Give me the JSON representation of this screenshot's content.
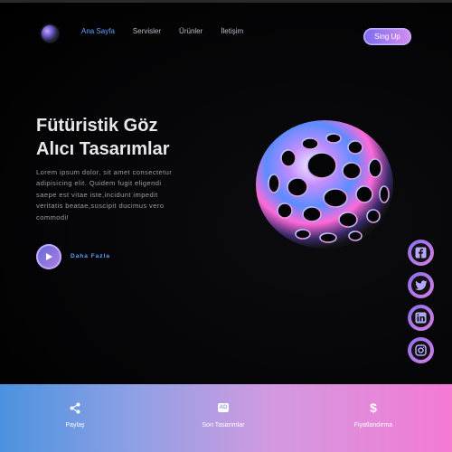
{
  "header": {
    "nav": [
      "Ana Sayfa",
      "Servisler",
      "Ürünler",
      "İletişim"
    ],
    "cta_label": "Sing Up",
    "logo_icon": "sphere-logo"
  },
  "hero": {
    "title_line1": "Fütüristik Göz",
    "title_line2": "Alıcı Tasarımlar",
    "lead": "Lorem ipsum dolor, sit amet consectetur adipisicing elit. Quidem fugit eligendi saepe est vitae iste,incidunt impedit veritatis beatae,suscipit ducimus vero commodi!",
    "more_label": "Daha Fazla",
    "play_icon": "play-icon"
  },
  "socials": [
    {
      "name": "facebook",
      "icon": "facebook-icon"
    },
    {
      "name": "twitter",
      "icon": "twitter-icon"
    },
    {
      "name": "linkedin",
      "icon": "linkedin-icon"
    },
    {
      "name": "instagram",
      "icon": "instagram-icon"
    }
  ],
  "footer": {
    "items": [
      {
        "label": "Paylaş",
        "icon": "share-icon"
      },
      {
        "label": "Son Tasarımlar",
        "icon": "ad-icon",
        "badge": "AD"
      },
      {
        "label": "Fiyatlandırma",
        "icon": "dollar-icon",
        "symbol": "$"
      }
    ]
  },
  "colors": {
    "accent_blue": "#5ea0ff",
    "gradient_start": "#4c92e0",
    "gradient_end": "#f47ad4",
    "button_gradient_start": "#7a6cf0",
    "button_gradient_end": "#d88cf0"
  }
}
